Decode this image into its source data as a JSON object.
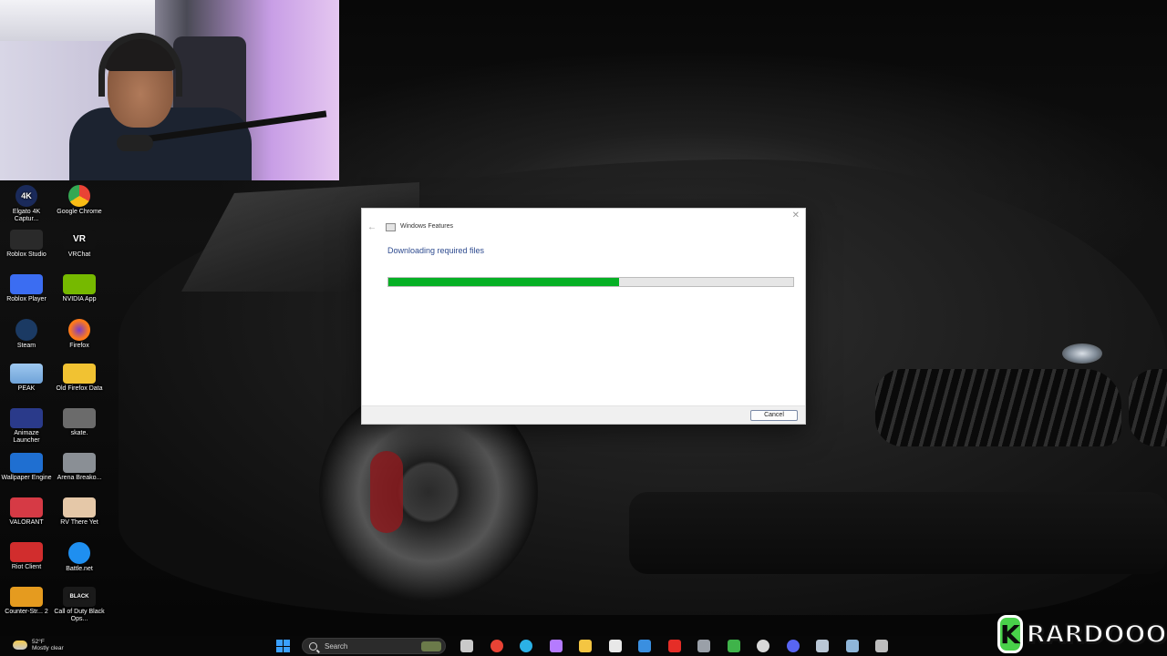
{
  "desktop": {
    "icons": [
      {
        "label": "Elgato 4K Captur...",
        "glyph": "4K",
        "color": "#1a2a5a"
      },
      {
        "label": "Google Chrome",
        "glyph": "",
        "color": "#e94335"
      },
      {
        "label": "Roblox Studio",
        "glyph": "",
        "color": "#2a2a2a"
      },
      {
        "label": "VRChat",
        "glyph": "VR",
        "color": "#111111"
      },
      {
        "label": "Roblox Player",
        "glyph": "",
        "color": "#3b6df2"
      },
      {
        "label": "NVIDIA App",
        "glyph": "",
        "color": "#76b900"
      },
      {
        "label": "Steam",
        "glyph": "",
        "color": "#1b3a63"
      },
      {
        "label": "Firefox",
        "glyph": "",
        "color": "#ff7a1a"
      },
      {
        "label": "PEAK",
        "glyph": "",
        "color": "#6fa3d8"
      },
      {
        "label": "Old Firefox Data",
        "glyph": "",
        "color": "#f1c232"
      },
      {
        "label": "Animaze Launcher",
        "glyph": "",
        "color": "#2a3a8a"
      },
      {
        "label": "skate.",
        "glyph": "",
        "color": "#6b6b6b"
      },
      {
        "label": "Wallpaper Engine",
        "glyph": "",
        "color": "#1f6fd1"
      },
      {
        "label": "Arena Breako...",
        "glyph": "",
        "color": "#8a8f95"
      },
      {
        "label": "VALORANT",
        "glyph": "",
        "color": "#d63a45"
      },
      {
        "label": "RV There Yet",
        "glyph": "",
        "color": "#e5c8a8"
      },
      {
        "label": "Riot Client",
        "glyph": "",
        "color": "#d12d2d"
      },
      {
        "label": "Battle.net",
        "glyph": "",
        "color": "#1f8ff0"
      },
      {
        "label": "Counter-Str... 2",
        "glyph": "",
        "color": "#e59b1f"
      },
      {
        "label": "Call of Duty Black Ops...",
        "glyph": "BLACK",
        "color": "#1a1a1a"
      }
    ]
  },
  "dialog": {
    "title": "Windows Features",
    "back_glyph": "←",
    "close_glyph": "✕",
    "heading": "Downloading required files",
    "progress_fraction": 0.57,
    "cancel_label": "Cancel"
  },
  "taskbar": {
    "weather": {
      "temp": "52°F",
      "condition": "Mostly clear"
    },
    "search_label": "Search",
    "pinned": [
      {
        "name": "file-explorer-icon",
        "color": "#c9c9c9"
      },
      {
        "name": "chrome-icon",
        "color": "#e94335"
      },
      {
        "name": "edge-icon",
        "color": "#2bb1e6"
      },
      {
        "name": "copilot-icon",
        "color": "#b57bff"
      },
      {
        "name": "folder-icon",
        "color": "#f4c542"
      },
      {
        "name": "store-icon",
        "color": "#e8e8e8"
      },
      {
        "name": "mail-icon",
        "color": "#3a8fe0"
      },
      {
        "name": "youtube-icon",
        "color": "#e52d27"
      },
      {
        "name": "controller-icon",
        "color": "#9aa0a8"
      },
      {
        "name": "xbox-icon",
        "color": "#3fb34a"
      },
      {
        "name": "obs-icon",
        "color": "#d8d8d8"
      },
      {
        "name": "discord-icon",
        "color": "#5865f2"
      },
      {
        "name": "steam-icon",
        "color": "#b9c7d6"
      },
      {
        "name": "steam-alt-icon",
        "color": "#8fb6d9"
      },
      {
        "name": "misc-app-icon",
        "color": "#bdbdbd"
      }
    ]
  },
  "streamer_logo": {
    "badge": "K",
    "name": "RARDOOO",
    "accent": "#49d14a"
  }
}
